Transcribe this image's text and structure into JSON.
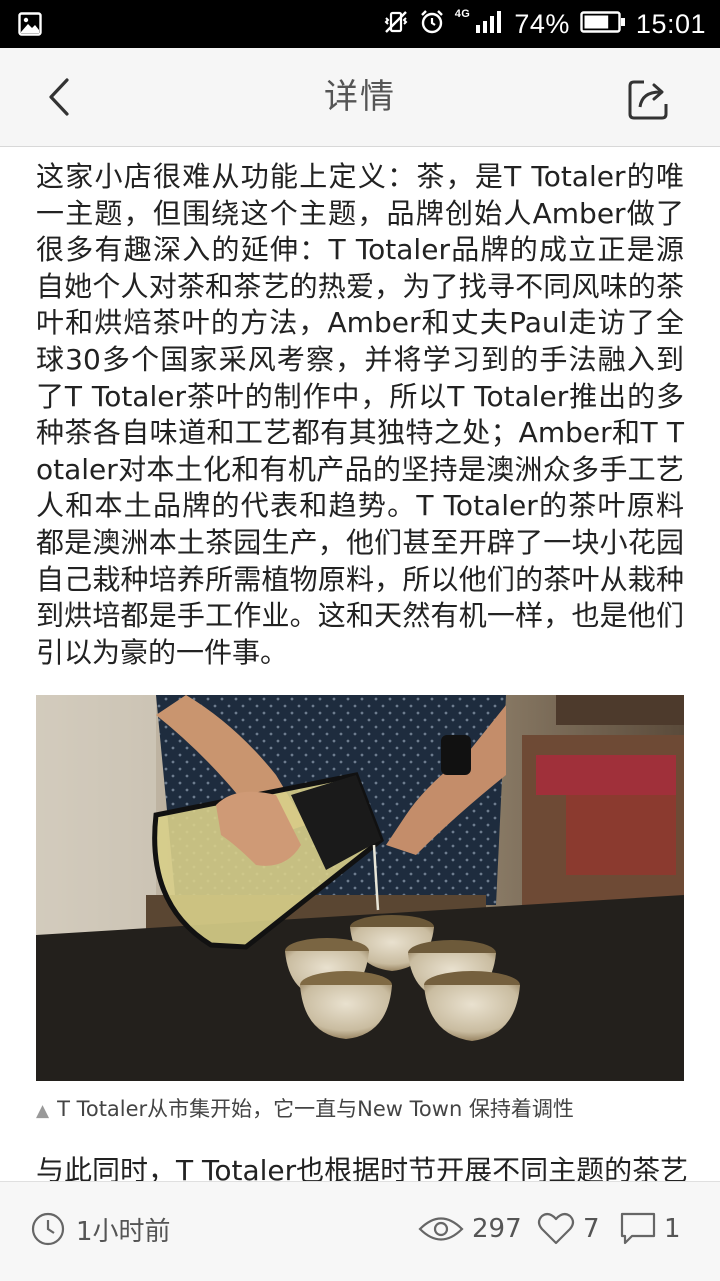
{
  "status_bar": {
    "battery_percent": "74%",
    "battery_level": 0.74,
    "network_type": "4G",
    "time": "15:01",
    "icons": [
      "image-notification-icon",
      "vibrate-off-icon",
      "alarm-icon",
      "signal-icon",
      "battery-icon"
    ]
  },
  "header": {
    "title": "详情",
    "back_icon": "chevron-left-icon",
    "share_icon": "share-icon"
  },
  "article": {
    "paragraph_1": "这家小店很难从功能上定义：茶，是T Totaler的唯一主题，但围绕这个主题，品牌创始人Amber做了很多有趣深入的延伸：T Totaler品牌的成立正是源自她个人对茶和茶艺的热爱，为了找寻不同风味的茶叶和烘焙茶叶的方法，Amber和丈夫Paul走访了全球30多个国家采风考察，并将学习到的手法融入到了T Totaler茶叶的制作中，所以T Totaler推出的多种茶各自味道和工艺都有其独特之处；Amber和T Totaler对本土化和有机产品的坚持是澳洲众多手工艺人和本土品牌的代表和趋势。T Totaler的茶叶原料都是澳洲本土茶园生产，他们甚至开辟了一块小花园自己栽种培养所需植物原料，所以他们的茶叶从栽种到烘培都是手工作业。这和天然有机一样，也是他们引以为豪的一件事。",
    "caption_marker": "▲",
    "caption": "T Totaler从市集开始，它一直与New Town 保持着调性",
    "paragraph_2_partial": "与此同时，T Totaler也根据时节开展不同主题的茶艺"
  },
  "footer": {
    "time_ago": "1小时前",
    "views": "297",
    "likes": "7",
    "comments": "1"
  },
  "colors": {
    "status_bar_bg": "#000000",
    "header_bg": "#f6f6f6",
    "body_bg": "#ffffff",
    "footer_bg": "#f7f7f7"
  }
}
